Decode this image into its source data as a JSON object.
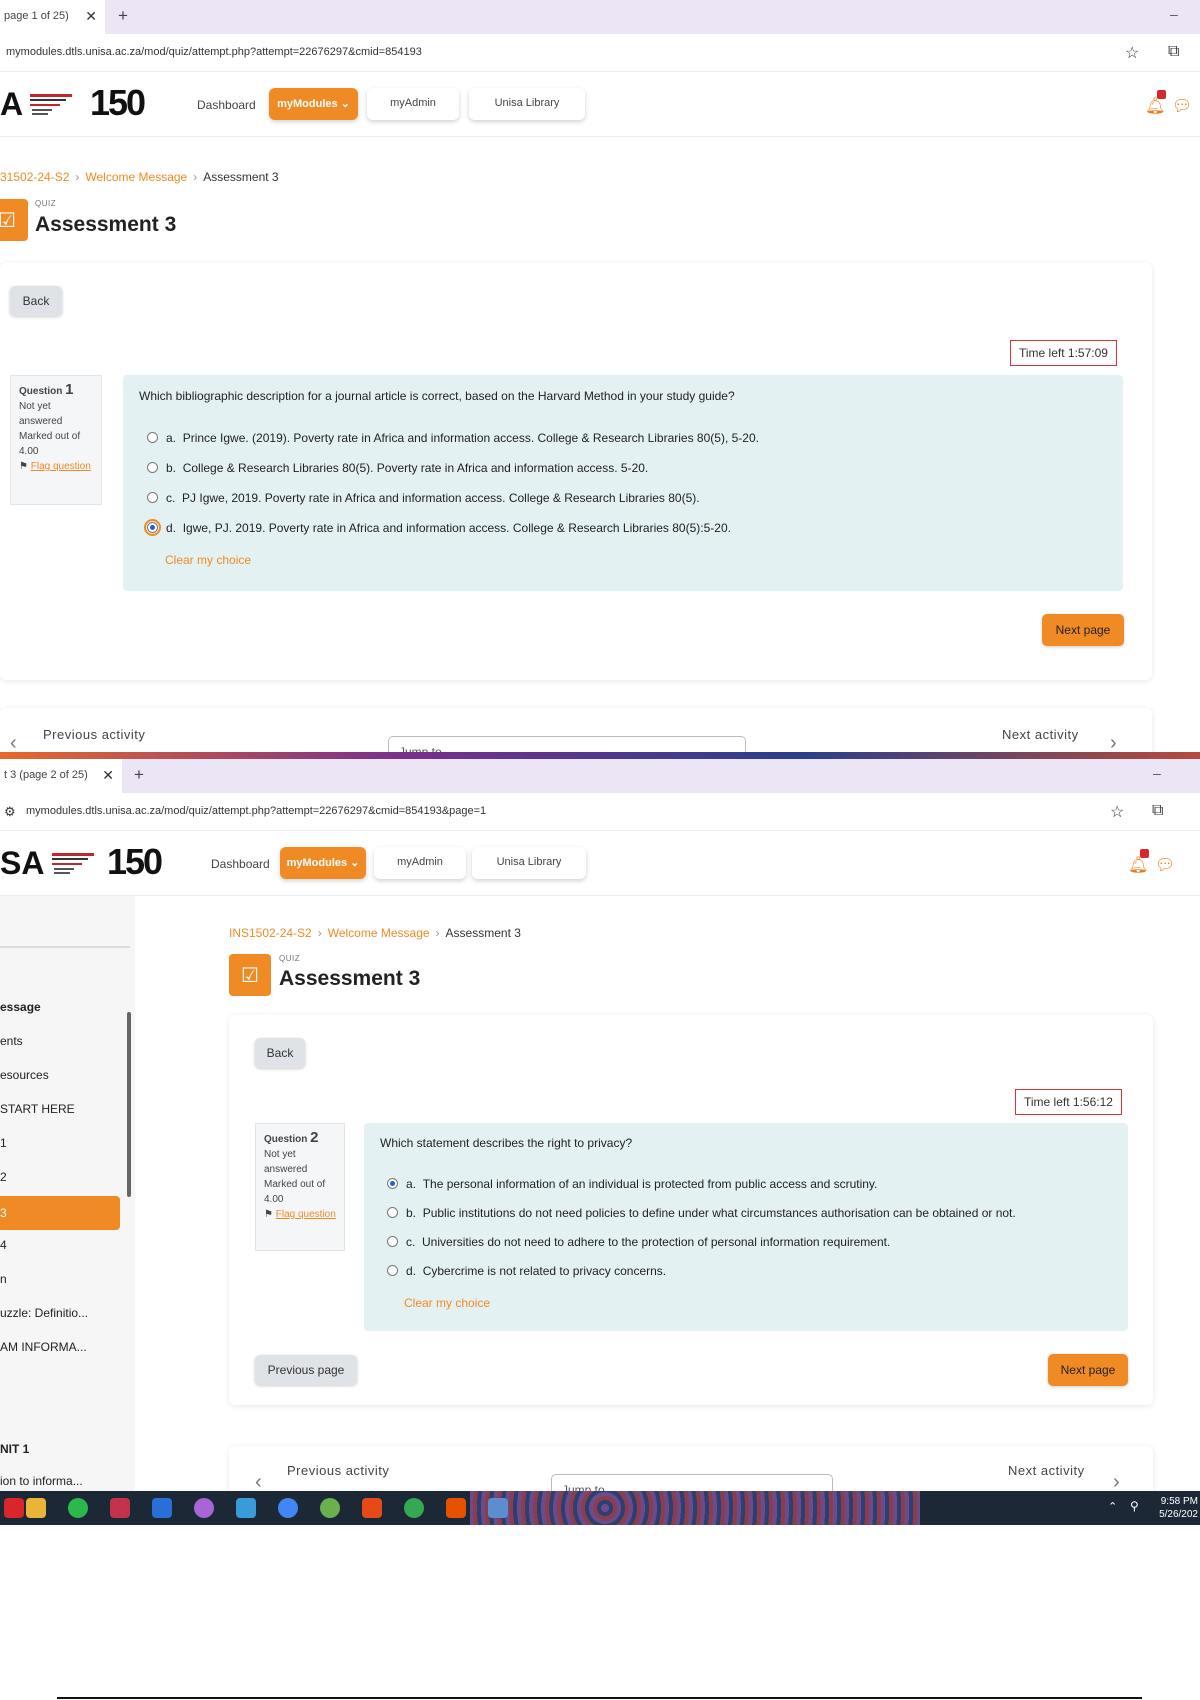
{
  "screen1": {
    "tab_title": "page 1 of 25)",
    "url": "mymodules.dtls.unisa.ac.za/mod/quiz/attempt.php?attempt=22676297&cmid=854193",
    "nav": {
      "dashboard": "Dashboard",
      "mymodules": "myModules",
      "myadmin": "myAdmin",
      "library": "Unisa Library"
    },
    "logo_letters": "A",
    "breadcrumb": {
      "course": "31502-24-S2",
      "welcome": "Welcome Message",
      "current": "Assessment 3"
    },
    "quiz_label": "QUIZ",
    "title": "Assessment 3",
    "back": "Back",
    "timer": "Time left 1:57:09",
    "question_info": {
      "label": "Question",
      "number": "1",
      "status": "Not yet answered",
      "marks": "Marked out of 4.00",
      "flag": "Flag question"
    },
    "question": "Which bibliographic description for a journal article is correct, based on the Harvard Method in your study guide?",
    "options": [
      {
        "letter": "a.",
        "text": "Prince Igwe. (2019). Poverty rate in Africa and information access. College & Research Libraries 80(5), 5-20."
      },
      {
        "letter": "b.",
        "text": "College & Research Libraries 80(5). Poverty rate in Africa and information access. 5-20."
      },
      {
        "letter": "c.",
        "text": "PJ Igwe, 2019. Poverty rate in Africa and information access. College & Research Libraries 80(5)."
      },
      {
        "letter": "d.",
        "text": "Igwe, PJ. 2019. Poverty rate in Africa and information access. College & Research Libraries 80(5):5-20."
      }
    ],
    "selected_option": "d.",
    "clear": "Clear my choice",
    "next_page": "Next page",
    "prev_activity": "Previous activity",
    "jump_to": "Jump to...",
    "next_activity": "Next activity"
  },
  "screen2": {
    "tab_title": "t 3 (page 2 of 25)",
    "url": "mymodules.dtls.unisa.ac.za/mod/quiz/attempt.php?attempt=22676297&cmid=854193&page=1",
    "nav": {
      "dashboard": "Dashboard",
      "mymodules": "myModules",
      "myadmin": "myAdmin",
      "library": "Unisa Library"
    },
    "logo_letters": "SA",
    "breadcrumb": {
      "course": "INS1502-24-S2",
      "welcome": "Welcome Message",
      "current": "Assessment 3"
    },
    "quiz_label": "QUIZ",
    "title": "Assessment 3",
    "sidebar": [
      "essage",
      "ents",
      "esources",
      "START HERE",
      "1",
      "2",
      "3",
      "4",
      "n",
      "uzzle: Definitio...",
      "AM INFORMA...",
      "NIT 1",
      "ion to informa..."
    ],
    "sidebar_active": "3",
    "back": "Back",
    "timer": "Time left 1:56:12",
    "question_info": {
      "label": "Question",
      "number": "2",
      "status": "Not yet answered",
      "marks": "Marked out of 4.00",
      "flag": "Flag question"
    },
    "question": "Which statement describes the right to privacy?",
    "options": [
      {
        "letter": "a.",
        "text": "The personal information of an individual is protected from public access and scrutiny."
      },
      {
        "letter": "b.",
        "text": "Public institutions do not need policies to define under what circumstances authorisation can be obtained or not."
      },
      {
        "letter": "c.",
        "text": "Universities do not need to adhere to the protection of personal information requirement."
      },
      {
        "letter": "d.",
        "text": "Cybercrime is not related to privacy concerns."
      }
    ],
    "selected_option": "a.",
    "clear": "Clear my choice",
    "prev_page": "Previous page",
    "next_page": "Next page",
    "prev_activity": "Previous activity",
    "jump_to": "Jump to...",
    "next_activity": "Next activity"
  },
  "taskbar": {
    "time": "9:58 PM",
    "date": "5/26/202"
  },
  "colors": {
    "accent": "#f08a24",
    "question_bg": "#e4f1f3",
    "tab_bar": "#ece5f6"
  }
}
